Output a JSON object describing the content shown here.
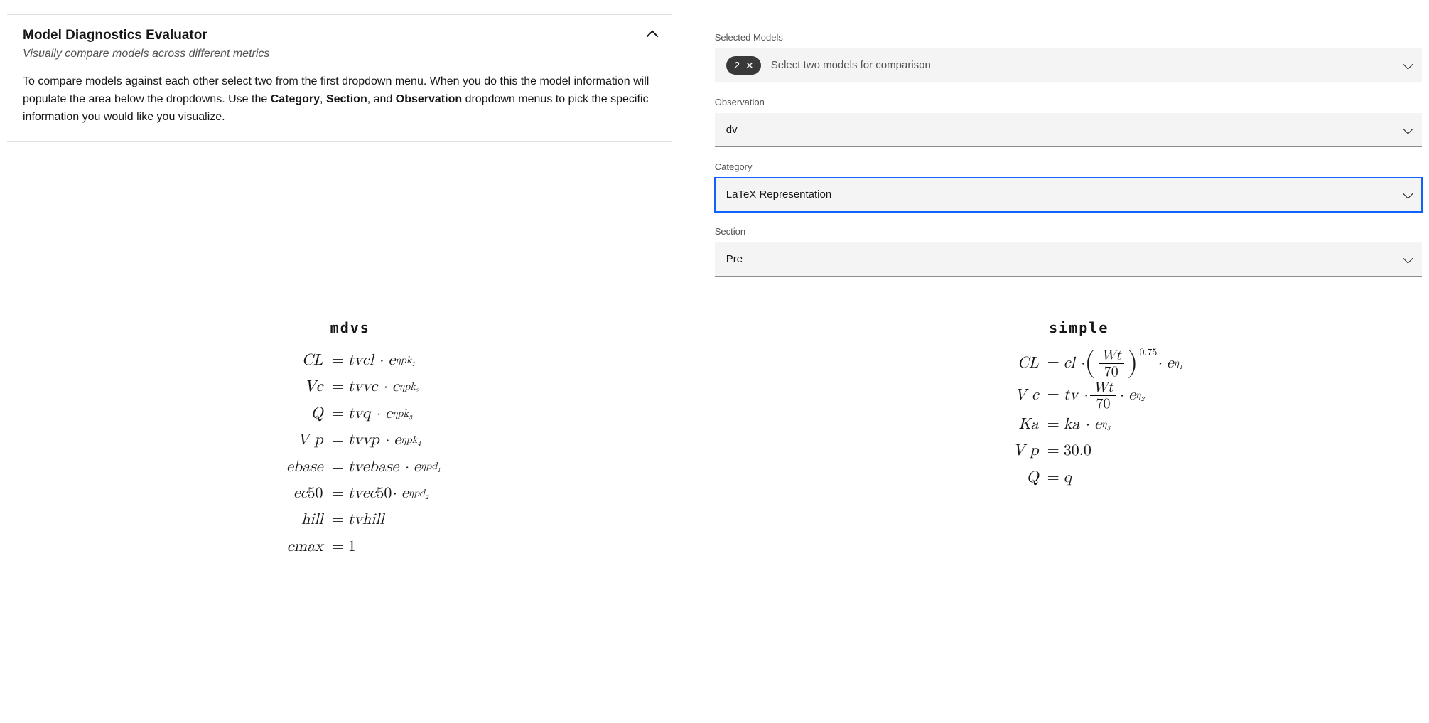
{
  "panel": {
    "title": "Model Diagnostics Evaluator",
    "subtitle": "Visually compare models across different metrics",
    "description_pre": "To compare models against each other select two from the first dropdown menu. When you do this the model information will populate the area below the dropdowns. Use the ",
    "b1": "Category",
    "sep1": ", ",
    "b2": "Section",
    "sep2": ", and ",
    "b3": "Observation",
    "description_post": " dropdown menus to pick the specific information you would like you visualize."
  },
  "controls": {
    "selected_models": {
      "label": "Selected Models",
      "chip_count": "2",
      "placeholder": "Select two models for comparison"
    },
    "observation": {
      "label": "Observation",
      "value": "dv"
    },
    "category": {
      "label": "Category",
      "value": "LaTeX Representation"
    },
    "section": {
      "label": "Section",
      "value": "Pre"
    }
  },
  "models": {
    "left": {
      "name": "mdvs",
      "equations": [
        {
          "lhs": "CL",
          "rhs_html": "tvcl · e<sup>ηpk<sub>1</sub></sup>"
        },
        {
          "lhs": "Vc",
          "rhs_html": "tvvc · e<sup>ηpk<sub>2</sub></sup>"
        },
        {
          "lhs": "Q",
          "rhs_html": "tvq · e<sup>ηpk<sub>3</sub></sup>"
        },
        {
          "lhs": "V p",
          "rhs_html": "tvvp · e<sup>ηpk<sub>4</sub></sup>"
        },
        {
          "lhs": "ebase",
          "rhs_html": "tvebase · e<sup>ηpd<sub>1</sub></sup>"
        },
        {
          "lhs": "ec<span class='upright'>50</span>",
          "rhs_html": "tvec<span class='upright'>50</span> · e<sup>ηpd<sub>2</sub></sup>"
        },
        {
          "lhs": "hill",
          "rhs_html": "tvhill"
        },
        {
          "lhs": "emax",
          "rhs_html": "<span class='upright'>1</span>"
        }
      ]
    },
    "right": {
      "name": "simple",
      "equations": [
        {
          "lhs": "CL",
          "rhs_html": "cl · <span class='bigparen'>(</span><span class='frac'><span class='num'>Wt</span><span class='den upright'>70</span></span><span class='bigparen'>)</span><span class='supout'>0.75</span> · e<sup>η<sub>1</sub></sup>"
        },
        {
          "lhs": "V c",
          "rhs_html": "tv · <span class='frac'><span class='num'>Wt</span><span class='den upright'>70</span></span> · e<sup>η<sub>2</sub></sup>"
        },
        {
          "lhs": "Ka",
          "rhs_html": "ka · e<sup>η<sub>3</sub></sup>"
        },
        {
          "lhs": "V p",
          "rhs_html": "<span class='upright'>30.0</span>"
        },
        {
          "lhs": "Q",
          "rhs_html": "q"
        }
      ]
    }
  }
}
